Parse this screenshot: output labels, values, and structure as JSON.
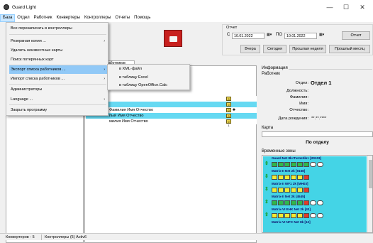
{
  "window": {
    "title": "Guard Light",
    "minimize": "—",
    "maximize": "☐",
    "close": "✕"
  },
  "menubar": [
    "База",
    "Отдел",
    "Работник",
    "Конвертеры",
    "Контроллеры",
    "Отчеты",
    "Помощь"
  ],
  "base_menu": {
    "items": [
      "Все перезаписать в контроллеры",
      "Резервная копия ...",
      "Удалить неизвестные карты",
      "Поиск потерянных карт",
      "Экспорт списка работников ...",
      "Импорт списка работников ...",
      "Администраторы",
      "Language ...",
      "Закрыть программу"
    ],
    "submenu_arrow": "›"
  },
  "export_submenu": [
    "в XML-файл",
    "в таблицу Excel",
    "в таблицу OpenOffice.Calc"
  ],
  "tab_label": "аботников",
  "employees": [
    {
      "name": "",
      "icon": "☺1"
    },
    {
      "name": "",
      "icon": "☺1"
    },
    {
      "name": "Фамилия Имя Отчество",
      "icon": "☺2",
      "extra": "♣"
    },
    {
      "name": "пый Имя Отчество",
      "icon": "☺1"
    },
    {
      "name": "милия Имя Отчество",
      "icon": "☺1"
    }
  ],
  "report": {
    "title": "Отчет",
    "from_prefix": "С",
    "from": "10.01.2022",
    "to_prefix": "ПО",
    "to": "10.01.2022",
    "btn_report": "Отчет",
    "btn_yesterday": "Вчера",
    "btn_today": "Сегодня",
    "btn_last_week": "Прошлая неделя",
    "btn_last_month": "Прошлый месяц"
  },
  "info": {
    "section": "Информация",
    "worker": "Работник",
    "dept_label": "Отдел:",
    "dept_value": "Отдел 1",
    "position_label": "Должность:",
    "surname_label": "Фамилия:",
    "name_label": "Имя:",
    "patronymic_label": "Отчество:",
    "birth_label": "Дата рождения:",
    "birth_value": "**.**.****"
  },
  "card": {
    "section": "Карта",
    "by_dept": "По отделу"
  },
  "timezones": {
    "section": "Временные зоны",
    "items": [
      "Guard Net 8k<Turnstile> [20103]",
      "Matrix-II Net 2k [9158]",
      "Matrix-II WF1 2k [MH03]",
      "Matrix-II Net 2k [4545]",
      "Matrix-VI EHK Net 2k [43]",
      "Matrix-VI NFC Net 8k [12]"
    ]
  },
  "status": {
    "converters": "Конвертеров - 5",
    "controllers": "Контроллеры (5) Activ6"
  },
  "colors": {
    "selected_row": "#66d9f2",
    "zone_bg": "#44d4e6",
    "menu_highlight": "#91c9f7"
  }
}
